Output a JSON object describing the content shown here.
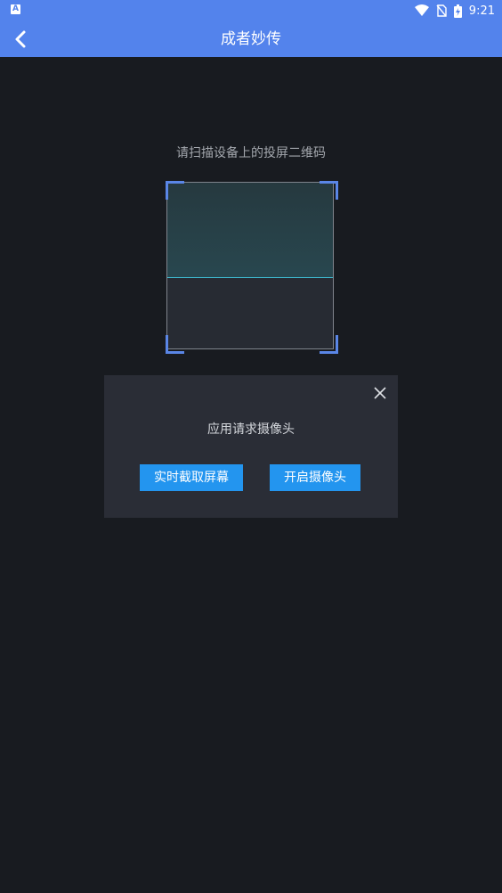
{
  "status_bar": {
    "notification_icon": "A",
    "time": "9:21"
  },
  "header": {
    "title": "成者妙传"
  },
  "scanner": {
    "hint": "请扫描设备上的投屏二维码"
  },
  "dialog": {
    "message": "应用请求摄像头",
    "capture_screen_label": "实时截取屏幕",
    "open_camera_label": "开启摄像头"
  },
  "colors": {
    "app_bar": "#5383ec",
    "background": "#181b20",
    "button": "#2395ef",
    "scan_line": "#3fc0d6"
  }
}
